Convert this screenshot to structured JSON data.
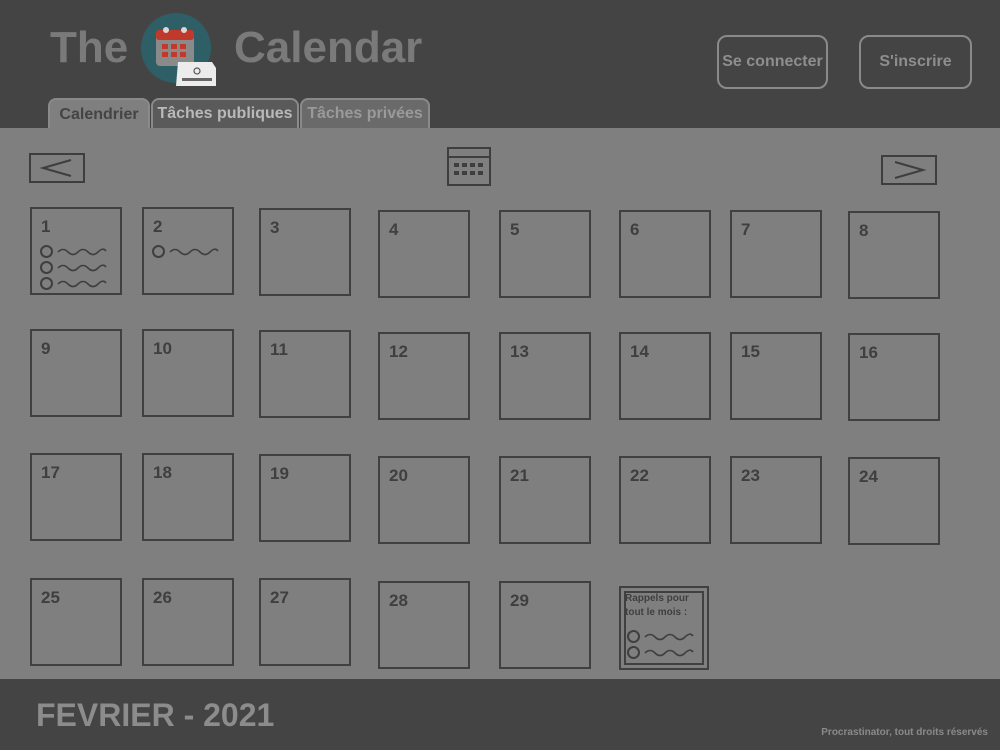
{
  "header": {
    "title_left": "The",
    "title_right": "Calendar",
    "login_label": "Se connecter",
    "signup_label": "S'inscrire"
  },
  "tabs": [
    {
      "label": "Calendrier",
      "active": true
    },
    {
      "label": "Tâches publiques",
      "active": false
    },
    {
      "label": "Tâches privées",
      "active": false
    }
  ],
  "nav": {
    "prev_icon": "chevron-left-icon",
    "calendar_icon": "calendar-icon",
    "next_icon": "chevron-right-icon"
  },
  "days": [
    {
      "num": "1",
      "tasks": 3
    },
    {
      "num": "2",
      "tasks": 1
    },
    {
      "num": "3",
      "tasks": 0
    },
    {
      "num": "4",
      "tasks": 0
    },
    {
      "num": "5",
      "tasks": 0
    },
    {
      "num": "6",
      "tasks": 0
    },
    {
      "num": "7",
      "tasks": 0
    },
    {
      "num": "8",
      "tasks": 0
    },
    {
      "num": "9",
      "tasks": 0
    },
    {
      "num": "10",
      "tasks": 0
    },
    {
      "num": "11",
      "tasks": 0
    },
    {
      "num": "12",
      "tasks": 0
    },
    {
      "num": "13",
      "tasks": 0
    },
    {
      "num": "14",
      "tasks": 0
    },
    {
      "num": "15",
      "tasks": 0
    },
    {
      "num": "16",
      "tasks": 0
    },
    {
      "num": "17",
      "tasks": 0
    },
    {
      "num": "18",
      "tasks": 0
    },
    {
      "num": "19",
      "tasks": 0
    },
    {
      "num": "20",
      "tasks": 0
    },
    {
      "num": "21",
      "tasks": 0
    },
    {
      "num": "22",
      "tasks": 0
    },
    {
      "num": "23",
      "tasks": 0
    },
    {
      "num": "24",
      "tasks": 0
    },
    {
      "num": "25",
      "tasks": 0
    },
    {
      "num": "26",
      "tasks": 0
    },
    {
      "num": "27",
      "tasks": 0
    },
    {
      "num": "28",
      "tasks": 0
    },
    {
      "num": "29",
      "tasks": 0
    }
  ],
  "reminder": {
    "title": "Rappels pour tout le mois :",
    "tasks": 2
  },
  "footer": {
    "month": "FEVRIER - 2021",
    "copyright": "Procrastinator, tout droits réservés"
  },
  "colors": {
    "header_bg": "#444444",
    "content_bg": "#7f7f7f",
    "logo_circle": "#2e5f66",
    "logo_red": "#c0392b"
  }
}
